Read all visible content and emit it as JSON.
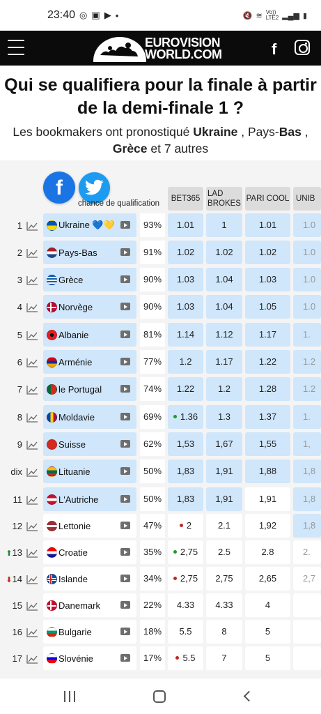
{
  "status": {
    "time": "23:40",
    "network": "Vo))\nLTE2"
  },
  "header": {
    "logo_line1": "EUROVISION",
    "logo_line2": "WORLD.COM"
  },
  "page": {
    "title": "Qui se qualifiera pour la finale à partir de la demi-finale 1 ?",
    "subtitle_prefix": "Les bookmakers ont pronostiqué ",
    "subtitle_c1": "Ukraine",
    "subtitle_sep1": " , Pays-",
    "subtitle_c2": "Bas",
    "subtitle_sep2": " , ",
    "subtitle_c3": "Grèce",
    "subtitle_suffix": " et 7 autres"
  },
  "table": {
    "chance_label": "chance de qualification",
    "bookmakers": [
      "BET365",
      "LAD\nBROKES",
      "PARI COOL",
      "UNIB"
    ],
    "rows": [
      {
        "rank": "1",
        "country": "Ukraine 💙💛",
        "flag": "ua",
        "pct": "93%",
        "odds": [
          "1.01",
          "1",
          "1.01",
          "1.0"
        ],
        "bg": [
          "b",
          "b",
          "b",
          "b"
        ],
        "dot": ""
      },
      {
        "rank": "2",
        "country": "Pays-Bas",
        "flag": "nl",
        "pct": "91%",
        "odds": [
          "1.02",
          "1.02",
          "1.02",
          "1.0"
        ],
        "bg": [
          "b",
          "b",
          "b",
          "b"
        ],
        "dot": ""
      },
      {
        "rank": "3",
        "country": "Grèce",
        "flag": "gr",
        "pct": "90%",
        "odds": [
          "1.03",
          "1.04",
          "1.03",
          "1.0"
        ],
        "bg": [
          "b",
          "b",
          "b",
          "b"
        ],
        "dot": ""
      },
      {
        "rank": "4",
        "country": "Norvège",
        "flag": "no",
        "pct": "90%",
        "odds": [
          "1.03",
          "1.04",
          "1.05",
          "1.0"
        ],
        "bg": [
          "b",
          "b",
          "b",
          "b"
        ],
        "dot": ""
      },
      {
        "rank": "5",
        "country": "Albanie",
        "flag": "al",
        "pct": "81%",
        "odds": [
          "1.14",
          "1.12",
          "1.17",
          "1."
        ],
        "bg": [
          "b",
          "b",
          "b",
          "b"
        ],
        "dot": ""
      },
      {
        "rank": "6",
        "country": "Arménie",
        "flag": "am",
        "pct": "77%",
        "odds": [
          "1.2",
          "1.17",
          "1.22",
          "1.2"
        ],
        "bg": [
          "b",
          "b",
          "b",
          "b"
        ],
        "dot": ""
      },
      {
        "rank": "7",
        "country": "le Portugal",
        "flag": "pt",
        "pct": "74%",
        "odds": [
          "1.22",
          "1.2",
          "1.28",
          "1.2"
        ],
        "bg": [
          "b",
          "b",
          "b",
          "b"
        ],
        "dot": ""
      },
      {
        "rank": "8",
        "country": "Moldavie",
        "flag": "md",
        "pct": "69%",
        "odds": [
          "1.36",
          "1.3",
          "1.37",
          "1."
        ],
        "bg": [
          "b",
          "b",
          "b",
          "b"
        ],
        "dot": "green"
      },
      {
        "rank": "9",
        "country": "Suisse",
        "flag": "ch",
        "pct": "62%",
        "odds": [
          "1,53",
          "1,67",
          "1,55",
          "1,"
        ],
        "bg": [
          "b",
          "b",
          "b",
          "b"
        ],
        "dot": ""
      },
      {
        "rank": "dix",
        "country": "Lituanie",
        "flag": "lt",
        "pct": "50%",
        "odds": [
          "1,83",
          "1,91",
          "1,88",
          "1,8"
        ],
        "bg": [
          "b",
          "b",
          "b",
          "b"
        ],
        "dot": ""
      },
      {
        "rank": "11",
        "country": "L'Autriche",
        "flag": "at",
        "pct": "50%",
        "odds": [
          "1,83",
          "1,91",
          "1,91",
          "1,8"
        ],
        "bg": [
          "b",
          "b",
          "w",
          "b"
        ],
        "dot": ""
      },
      {
        "rank": "12",
        "country": "Lettonie",
        "flag": "lv",
        "pct": "47%",
        "odds": [
          "2",
          "2.1",
          "1,92",
          "1,8"
        ],
        "bg": [
          "w",
          "w",
          "w",
          "b"
        ],
        "dot": "red"
      },
      {
        "rank": "13",
        "country": "Croatie",
        "flag": "hr",
        "pct": "35%",
        "odds": [
          "2,75",
          "2.5",
          "2.8",
          "2."
        ],
        "bg": [
          "w",
          "w",
          "w",
          "w"
        ],
        "dot": "green",
        "move": "up"
      },
      {
        "rank": "14",
        "country": "Islande",
        "flag": "is",
        "pct": "34%",
        "odds": [
          "2,75",
          "2,75",
          "2,65",
          "2,7"
        ],
        "bg": [
          "w",
          "w",
          "w",
          "w"
        ],
        "dot": "red",
        "move": "down"
      },
      {
        "rank": "15",
        "country": "Danemark",
        "flag": "dk",
        "pct": "22%",
        "odds": [
          "4.33",
          "4.33",
          "4",
          ""
        ],
        "bg": [
          "w",
          "w",
          "w",
          "w"
        ],
        "dot": ""
      },
      {
        "rank": "16",
        "country": "Bulgarie",
        "flag": "bg",
        "pct": "18%",
        "odds": [
          "5.5",
          "8",
          "5",
          ""
        ],
        "bg": [
          "w",
          "w",
          "w",
          "w"
        ],
        "dot": ""
      },
      {
        "rank": "17",
        "country": "Slovénie",
        "flag": "si",
        "pct": "17%",
        "odds": [
          "5.5",
          "7",
          "5",
          ""
        ],
        "bg": [
          "w",
          "w",
          "w",
          "w"
        ],
        "dot": "red"
      }
    ]
  },
  "colors": {
    "brand_dark": "#0b0b0b",
    "fb": "#1b74e4",
    "tw": "#1d9bf0",
    "cell_blue": "#cfe6fb",
    "dot_green": "#1d9b2e",
    "dot_red": "#c0271e"
  }
}
